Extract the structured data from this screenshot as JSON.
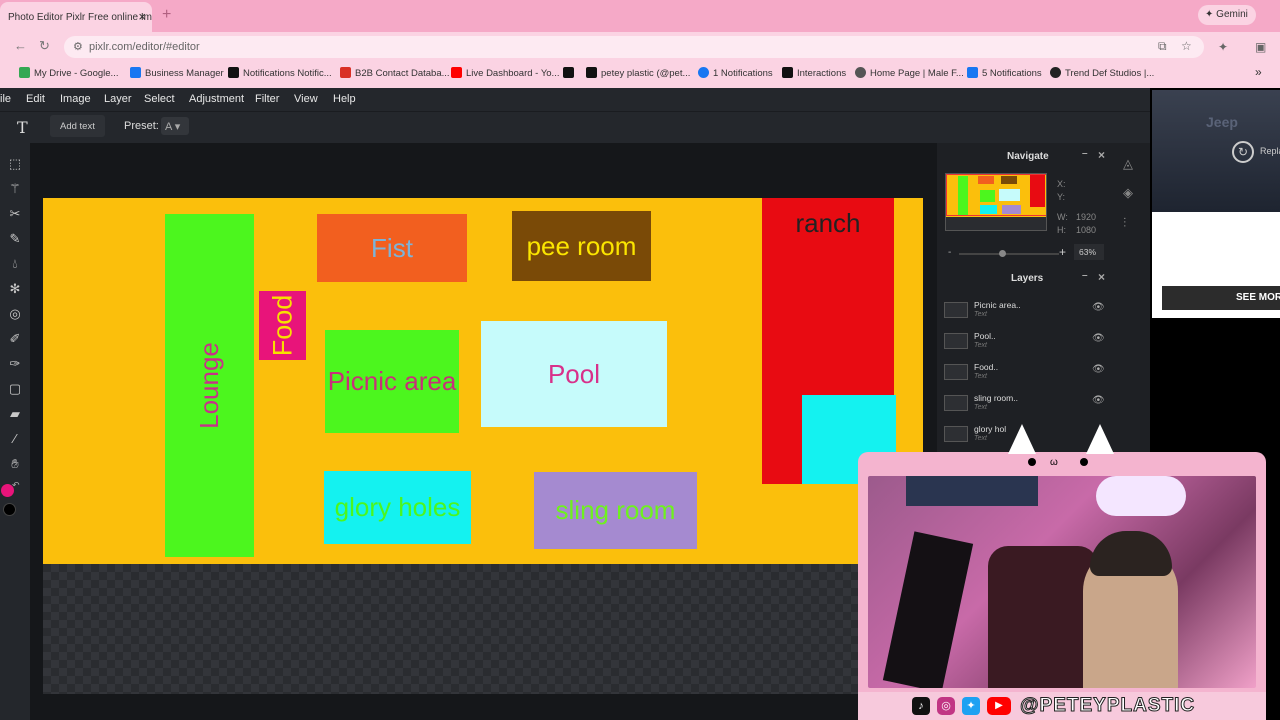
{
  "browser": {
    "tab_title": "Photo Editor Pixlr Free online Im",
    "tab_close": "×",
    "new_tab": "+",
    "gemini_label": "Gemini",
    "url": "pixlr.com/editor/#editor",
    "bookmarks": [
      {
        "label": "My Drive - Google...",
        "color": "#34a853"
      },
      {
        "label": "Business Manager",
        "color": "#1877f2"
      },
      {
        "label": "Notifications Notific...",
        "color": "#111111"
      },
      {
        "label": "B2B Contact Databa...",
        "color": "#d93025"
      },
      {
        "label": "Live Dashboard - Yo...",
        "color": "#ff0000"
      },
      {
        "label": "",
        "color": "#111111"
      },
      {
        "label": "petey plastic (@pet...",
        "color": "#111111"
      },
      {
        "label": "1 Notifications",
        "color": "#1877f2"
      },
      {
        "label": "Interactions",
        "color": "#111111"
      },
      {
        "label": "Home Page | Male F...",
        "color": "#555555"
      },
      {
        "label": "5 Notifications",
        "color": "#1877f2"
      },
      {
        "label": "Trend Def Studios |...",
        "color": "#222222"
      }
    ],
    "bookmarks_more": "»"
  },
  "editor": {
    "menu": [
      "ile",
      "Edit",
      "Image",
      "Layer",
      "Select",
      "Adjustment",
      "Filter",
      "View",
      "Help"
    ],
    "options": {
      "add_text": "Add text",
      "preset_label": "Preset:",
      "preset_value": "A"
    },
    "tools": [
      "marquee-icon",
      "wand-icon",
      "scissors-icon",
      "brush-icon",
      "drop-icon",
      "clone-icon",
      "focus-icon",
      "pen-icon",
      "picker-icon",
      "shape-icon",
      "eraser-icon",
      "dropper-icon",
      "hand-icon"
    ]
  },
  "canvas": {
    "rooms": [
      {
        "id": "lounge",
        "label": "Lounge",
        "bg": "#4cf61e",
        "fg": "#c8308a"
      },
      {
        "id": "food",
        "label": "Food",
        "bg": "#e8147a",
        "fg": "#f7e000"
      },
      {
        "id": "fist",
        "label": "Fist",
        "bg": "#f25f1f",
        "fg": "#7db3d8"
      },
      {
        "id": "pee-room",
        "label": "pee room",
        "bg": "#7a4a07",
        "fg": "#fbe500"
      },
      {
        "id": "picnic",
        "label": "Picnic area",
        "bg": "#4cf61e",
        "fg": "#c8307a"
      },
      {
        "id": "pool",
        "label": "Pool",
        "bg": "#c6fbfb",
        "fg": "#d8308a"
      },
      {
        "id": "ranch",
        "label": "ranch",
        "bg": "#e80b12",
        "fg": "#222222"
      },
      {
        "id": "ranch-cyan",
        "label": "",
        "bg": "#14f2f0",
        "fg": "#14f2f0"
      },
      {
        "id": "glory-holes",
        "label": "glory holes",
        "bg": "#14f2f0",
        "fg": "#4cf61e"
      },
      {
        "id": "sling-room",
        "label": "sling room",
        "bg": "#a58ad0",
        "fg": "#6ef21e"
      }
    ],
    "background": "#fbbf0c"
  },
  "navigate": {
    "title": "Navigate",
    "x_label": "X:",
    "y_label": "Y:",
    "w_label": "W:",
    "w_value": "1920",
    "h_label": "H:",
    "h_value": "1080",
    "zoom": "63%",
    "zoom_minus": "-",
    "zoom_plus": "+"
  },
  "layers": {
    "title": "Layers",
    "items": [
      {
        "name": "Picnic area..",
        "type": "Text"
      },
      {
        "name": "Pool..",
        "type": "Text"
      },
      {
        "name": "Food..",
        "type": "Text"
      },
      {
        "name": "sling room..",
        "type": "Text"
      },
      {
        "name": "glory hol",
        "type": "Text"
      }
    ]
  },
  "ad": {
    "brand": "Jeep",
    "replay": "Replay",
    "cta": "SEE MORE"
  },
  "webcam": {
    "handle": "@PETEYPLASTIC",
    "social_icons": [
      "tiktok-icon",
      "instagram-icon",
      "twitter-icon",
      "youtube-icon"
    ]
  }
}
